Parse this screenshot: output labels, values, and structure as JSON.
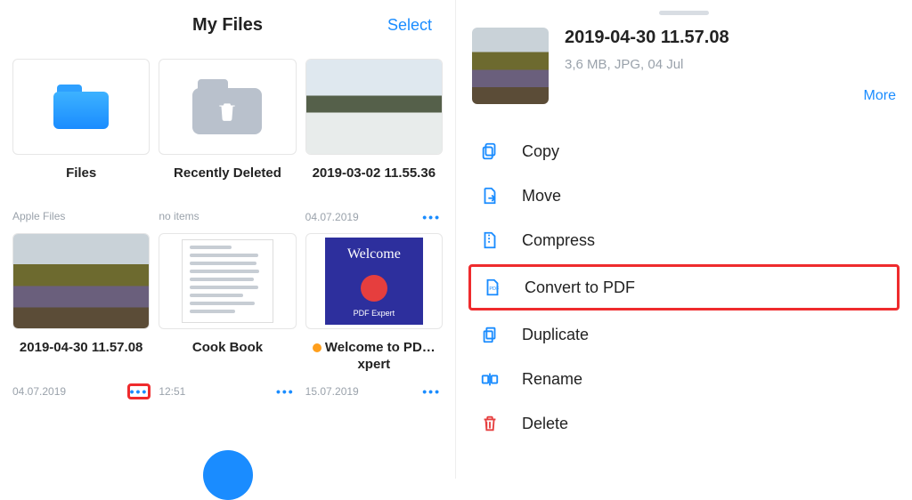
{
  "colors": {
    "accent": "#1a8cff",
    "danger": "#e63e3e",
    "highlight": "#ef2b2d"
  },
  "left": {
    "title": "My Files",
    "select_label": "Select",
    "tiles": [
      {
        "name": "Files",
        "subtitle": "Apple Files",
        "show_dots": false
      },
      {
        "name": "Recently Deleted",
        "subtitle": "no items",
        "show_dots": false
      },
      {
        "name": "2019-03-02 11.55.36",
        "subtitle": "04.07.2019",
        "show_dots": true
      },
      {
        "name": "2019-04-30 11.57.08",
        "subtitle": "04.07.2019",
        "show_dots": true,
        "dots_highlighted": true
      },
      {
        "name": "Cook Book",
        "subtitle": "12:51",
        "show_dots": true
      },
      {
        "name_prefix_dot": true,
        "name": "Welcome to PD…xpert",
        "subtitle": "15.07.2019",
        "show_dots": true
      }
    ]
  },
  "right": {
    "file_title": "2019-04-30 11.57.08",
    "file_meta": "3,6 MB, JPG, 04 Jul",
    "more_label": "More",
    "actions": [
      {
        "label": "Copy",
        "icon": "copy-icon"
      },
      {
        "label": "Move",
        "icon": "move-icon"
      },
      {
        "label": "Compress",
        "icon": "compress-icon"
      },
      {
        "label": "Convert to PDF",
        "icon": "pdf-icon",
        "highlighted": true
      },
      {
        "label": "Duplicate",
        "icon": "duplicate-icon"
      },
      {
        "label": "Rename",
        "icon": "rename-icon"
      },
      {
        "label": "Delete",
        "icon": "delete-icon",
        "danger": true
      }
    ]
  }
}
